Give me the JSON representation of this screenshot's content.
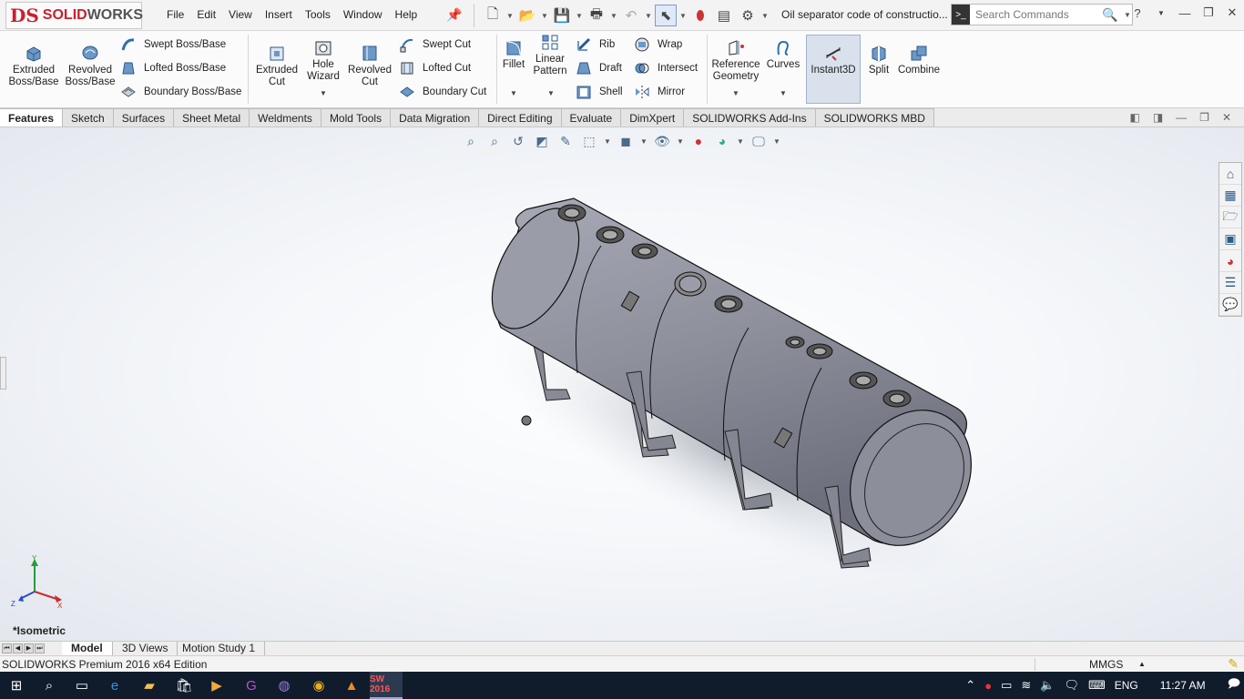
{
  "app": {
    "logo_text_ds": "DS",
    "logo_text_solid": "SOLID",
    "logo_text_works": "WORKS",
    "document_title": "Oil separator code of constructio..."
  },
  "menu": [
    "File",
    "Edit",
    "View",
    "Insert",
    "Tools",
    "Window",
    "Help"
  ],
  "search": {
    "placeholder": "Search Commands"
  },
  "commands": {
    "extruded_boss": "Extruded Boss/Base",
    "revolved_boss": "Revolved Boss/Base",
    "swept_boss": "Swept Boss/Base",
    "lofted_boss": "Lofted Boss/Base",
    "boundary_boss": "Boundary Boss/Base",
    "extruded_cut": "Extruded Cut",
    "hole_wizard": "Hole Wizard",
    "revolved_cut": "Revolved Cut",
    "swept_cut": "Swept Cut",
    "lofted_cut": "Lofted Cut",
    "boundary_cut": "Boundary Cut",
    "fillet": "Fillet",
    "linear_pattern": "Linear Pattern",
    "rib": "Rib",
    "draft": "Draft",
    "shell": "Shell",
    "wrap": "Wrap",
    "intersect": "Intersect",
    "mirror": "Mirror",
    "reference_geometry": "Reference Geometry",
    "curves": "Curves",
    "instant3d": "Instant3D",
    "split": "Split",
    "combine": "Combine"
  },
  "tabs": [
    "Features",
    "Sketch",
    "Surfaces",
    "Sheet Metal",
    "Weldments",
    "Mold Tools",
    "Data Migration",
    "Direct Editing",
    "Evaluate",
    "DimXpert",
    "SOLIDWORKS Add-Ins",
    "SOLIDWORKS MBD"
  ],
  "active_tab": "Features",
  "viewport": {
    "view_name": "*Isometric",
    "triad_x": "X",
    "triad_y": "Y",
    "triad_z": "Z"
  },
  "bottom_tabs": [
    "Model",
    "3D Views",
    "Motion Study 1"
  ],
  "status": {
    "text": "SOLIDWORKS Premium 2016 x64 Edition",
    "units": "MMGS"
  },
  "taskbar": {
    "language": "ENG",
    "time": "11:27 AM",
    "sw_badge": "SW 2016"
  },
  "colors": {
    "accent_red": "#cc1f2d",
    "model_gray": "#8e909c",
    "taskbar": "#101c2c"
  }
}
